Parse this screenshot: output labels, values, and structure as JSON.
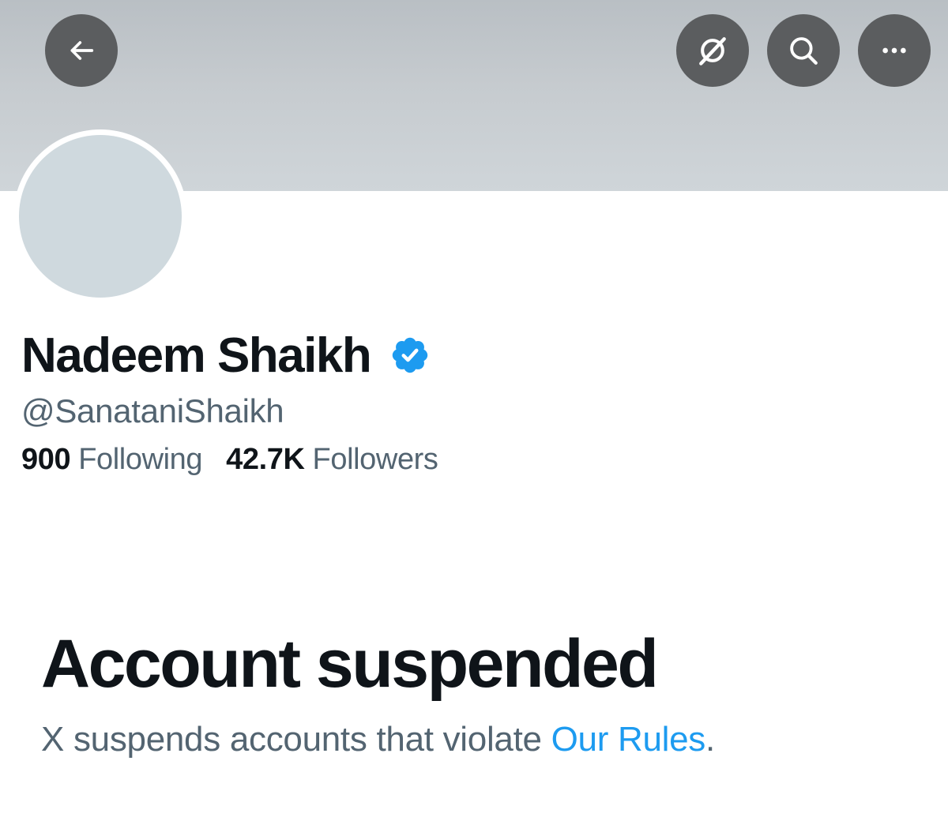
{
  "header": {
    "back_icon": "arrow-left-icon",
    "grok_icon": "grok-icon",
    "search_icon": "search-icon",
    "more_icon": "more-horizontal-icon",
    "banner_color": "#c6cbcf",
    "button_color": "#5b5d5f"
  },
  "profile": {
    "display_name": "Nadeem Shaikh",
    "verified_icon": "verified-badge-icon",
    "verified_color": "#1d9bf0",
    "handle": "@SanataniShaikh",
    "avatar_color": "#cfd9de"
  },
  "stats": {
    "following_count": "900",
    "following_label": "Following",
    "followers_count": "42.7K",
    "followers_label": "Followers"
  },
  "suspension": {
    "title": "Account suspended",
    "description": "X suspends accounts that violate",
    "link_text": "Our Rules",
    "trailing": ".",
    "link_color": "#1d9bf0"
  }
}
